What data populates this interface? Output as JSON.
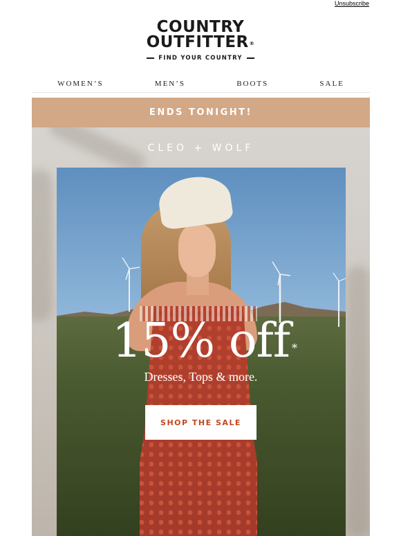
{
  "header": {
    "unsubscribe_label": "Unsubscribe",
    "logo": {
      "line1": "COUNTRY",
      "line2": "OUTFITTER",
      "registered": "®",
      "tagline": "FIND YOUR COUNTRY"
    }
  },
  "nav": {
    "items": [
      {
        "label": "WOMEN’S"
      },
      {
        "label": "MEN’S"
      },
      {
        "label": "BOOTS"
      },
      {
        "label": "SALE"
      }
    ]
  },
  "banner": {
    "text": "ENDS TONIGHT!",
    "background": "#d2a887"
  },
  "hero": {
    "brand": "CLEO + WOLF",
    "offer": "15% off",
    "offer_mark": "*",
    "subtitle": "Dresses, Tops & more.",
    "cta_label": "SHOP THE SALE",
    "cta_color": "#c2481f"
  }
}
